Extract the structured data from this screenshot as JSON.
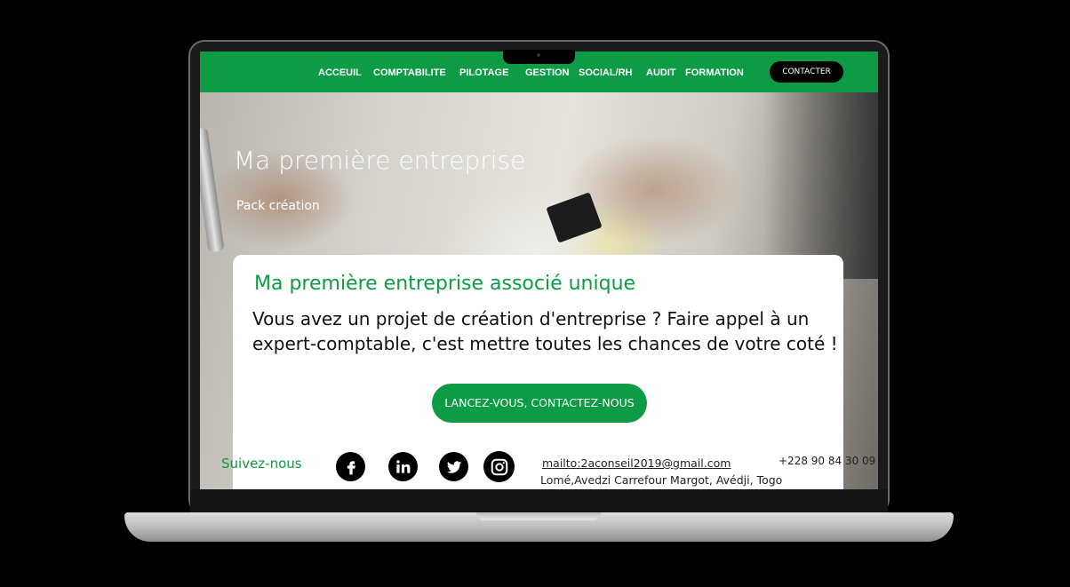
{
  "nav": {
    "items": [
      {
        "label": "ACCEUIL"
      },
      {
        "label": "COMPTABILITE"
      },
      {
        "label": "PILOTAGE"
      },
      {
        "label": "GESTION"
      },
      {
        "label": "SOCIAL/RH"
      },
      {
        "label": "AUDIT"
      },
      {
        "label": "FORMATION"
      }
    ],
    "contact_label": "CONTACTER"
  },
  "hero": {
    "title": "Ma première entreprise",
    "subtitle": "Pack création"
  },
  "card": {
    "title": "Ma première entreprise associé unique",
    "body": "Vous avez un projet de création d'entreprise ? Faire appel à un expert-comptable, c'est mettre toutes les chances de votre coté !",
    "cta_label": "LANCEZ-VOUS, CONTACTEZ-NOUS"
  },
  "footer": {
    "follow_label": "Suivez-nous",
    "social": [
      {
        "icon": "facebook-icon"
      },
      {
        "icon": "linkedin-icon"
      },
      {
        "icon": "twitter-icon"
      },
      {
        "icon": "instagram-icon"
      }
    ],
    "email": "mailto:2aconseil2019@gmail.com",
    "address": "Lomé,Avedzi Carrefour Margot, Avédji, Togo",
    "phone": "+228 90 84 30 09"
  },
  "colors": {
    "brand_green": "#0d9b45",
    "contact_button": "#000000"
  }
}
